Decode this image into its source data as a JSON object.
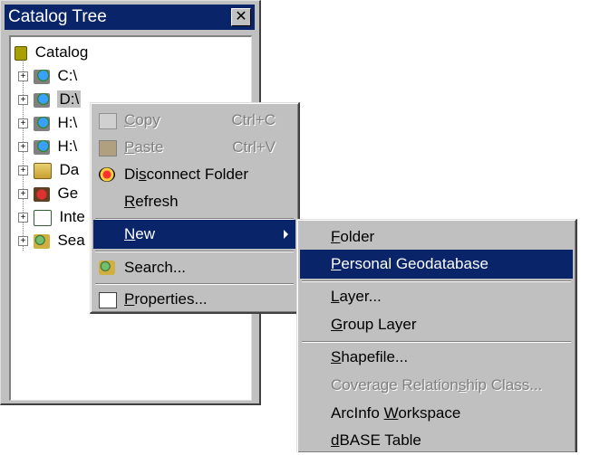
{
  "window": {
    "title": "Catalog Tree",
    "close_symbol": "✕"
  },
  "tree": {
    "root": {
      "label": "Catalog",
      "icon": "catalog-icon"
    },
    "items": [
      {
        "label": "C:\\",
        "icon": "drive-icon"
      },
      {
        "label": "D:\\",
        "icon": "drive-icon",
        "selected": true
      },
      {
        "label": "H:\\",
        "icon": "drive-icon"
      },
      {
        "label": "H:\\",
        "icon": "drive-icon"
      },
      {
        "label": "Da",
        "icon": "database-folder-icon"
      },
      {
        "label": "Ge",
        "icon": "geography-icon"
      },
      {
        "label": "Inte",
        "icon": "internet-server-icon"
      },
      {
        "label": "Sea",
        "icon": "search-results-icon"
      }
    ]
  },
  "context_menu": {
    "copy": {
      "pre": "",
      "key": "C",
      "post": "opy",
      "shortcut": "Ctrl+C",
      "icon": "copy-icon",
      "enabled": false
    },
    "paste": {
      "pre": "",
      "key": "P",
      "post": "aste",
      "shortcut": "Ctrl+V",
      "icon": "paste-icon",
      "enabled": false
    },
    "disconnect": {
      "pre": "Di",
      "key": "s",
      "post": "connect Folder",
      "icon": "disconnect-folder-icon"
    },
    "refresh": {
      "pre": "",
      "key": "R",
      "post": "efresh"
    },
    "new": {
      "pre": "",
      "key": "N",
      "post": "ew"
    },
    "search": {
      "label": "Search...",
      "icon": "search-icon"
    },
    "properties": {
      "pre": "",
      "key": "P",
      "post": "roperties...",
      "icon": "properties-icon"
    }
  },
  "new_submenu": {
    "folder": {
      "pre": "",
      "key": "F",
      "post": "older"
    },
    "personal_geodatabase": {
      "pre": "",
      "key": "P",
      "post": "ersonal Geodatabase"
    },
    "layer": {
      "pre": "",
      "key": "L",
      "post": "ayer..."
    },
    "group_layer": {
      "pre": "",
      "key": "G",
      "post": "roup Layer"
    },
    "shapefile": {
      "pre": "",
      "key": "S",
      "post": "hapefile..."
    },
    "coverage_relationship": {
      "pre": "Coverage Relation",
      "key": "s",
      "post": "hip Class...",
      "enabled": false
    },
    "arcinfo_workspace": {
      "pre": "ArcInfo ",
      "key": "W",
      "post": "orkspace"
    },
    "dbase_table": {
      "pre": "",
      "key": "d",
      "post": "BASE Table"
    }
  },
  "colors": {
    "highlight": "#0a246a",
    "face": "#c0c0c0",
    "disabled": "#808080"
  }
}
